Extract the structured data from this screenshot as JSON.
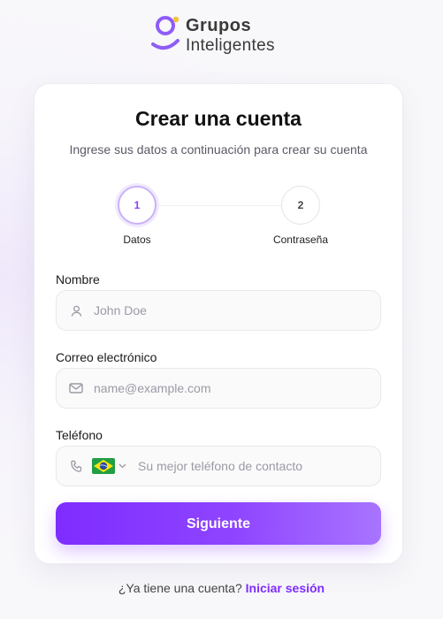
{
  "brand": {
    "line1": "Grupos",
    "line2": "Inteligentes"
  },
  "card": {
    "title": "Crear una cuenta",
    "subtitle": "Ingrese sus datos a continuación para crear su cuenta"
  },
  "stepper": {
    "steps": [
      {
        "number": "1",
        "label": "Datos",
        "active": true
      },
      {
        "number": "2",
        "label": "Contraseña",
        "active": false
      }
    ]
  },
  "form": {
    "name": {
      "label": "Nombre",
      "placeholder": "John Doe",
      "icon": "user-icon"
    },
    "email": {
      "label": "Correo electrónico",
      "placeholder": "name@example.com",
      "icon": "mail-icon"
    },
    "phone": {
      "label": "Teléfono",
      "placeholder": "Su mejor teléfono de contacto",
      "icon": "phone-icon",
      "country_flag": "brazil-flag"
    }
  },
  "submit": {
    "label": "Siguiente"
  },
  "footer": {
    "prompt": "¿Ya tiene una cuenta?",
    "link": "Iniciar sesión"
  },
  "colors": {
    "accent": "#7e2cff",
    "accent_light": "#a874ff"
  }
}
